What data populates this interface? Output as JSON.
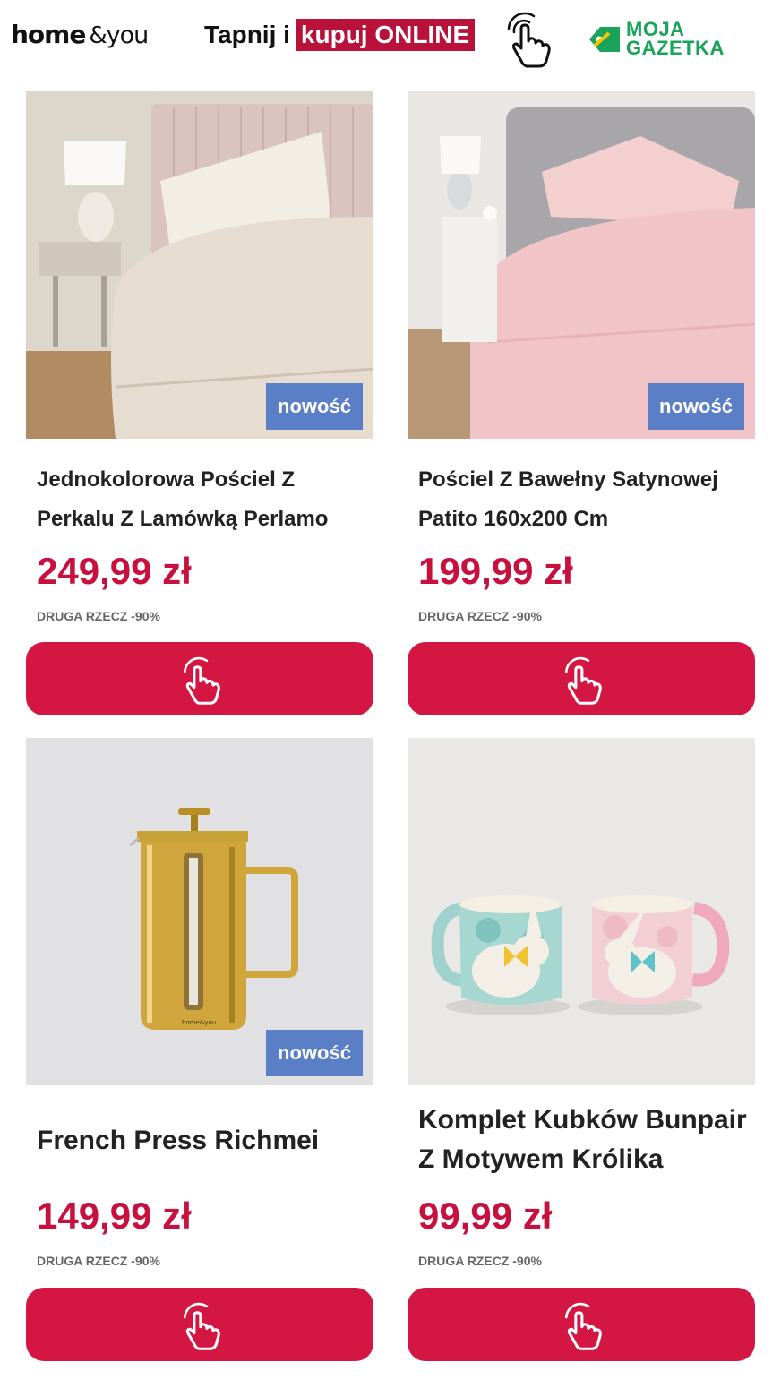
{
  "header": {
    "brand": {
      "home": "home",
      "amp": "&",
      "you": "you"
    },
    "tap_text": "Tapnij i",
    "tap_highlight": "kupuj ONLINE",
    "partner": {
      "line1": "MOJA",
      "line2": "GAZETKA"
    }
  },
  "colors": {
    "accent": "#d41642",
    "price": "#c8103e",
    "badge": "#5b7fc7",
    "partner": "#1aa35b"
  },
  "products": [
    {
      "title_line1": "Jednokolorowa Pościel Z",
      "title_line2": "Perkalu Z Lamówką Perlamo",
      "price": "249,99 zł",
      "promo": "DRUGA RZECZ -90%",
      "badge": "nowość",
      "icon": "tap-hand-icon"
    },
    {
      "title_line1": "Pościel Z Bawełny Satynowej",
      "title_line2": "Patito 160x200 Cm",
      "price": "199,99 zł",
      "promo": "DRUGA RZECZ -90%",
      "badge": "nowość",
      "icon": "tap-hand-icon"
    },
    {
      "title_line1": "French Press Richmei",
      "price": "149,99 zł",
      "promo": "DRUGA RZECZ -90%",
      "badge": "nowość",
      "product_print": "home&you",
      "icon": "tap-hand-icon"
    },
    {
      "title_line1": "Komplet Kubków Bunpair",
      "title_line2": "Z Motywem Królika",
      "price": "99,99 zł",
      "promo": "DRUGA RZECZ -90%",
      "icon": "tap-hand-icon"
    }
  ]
}
